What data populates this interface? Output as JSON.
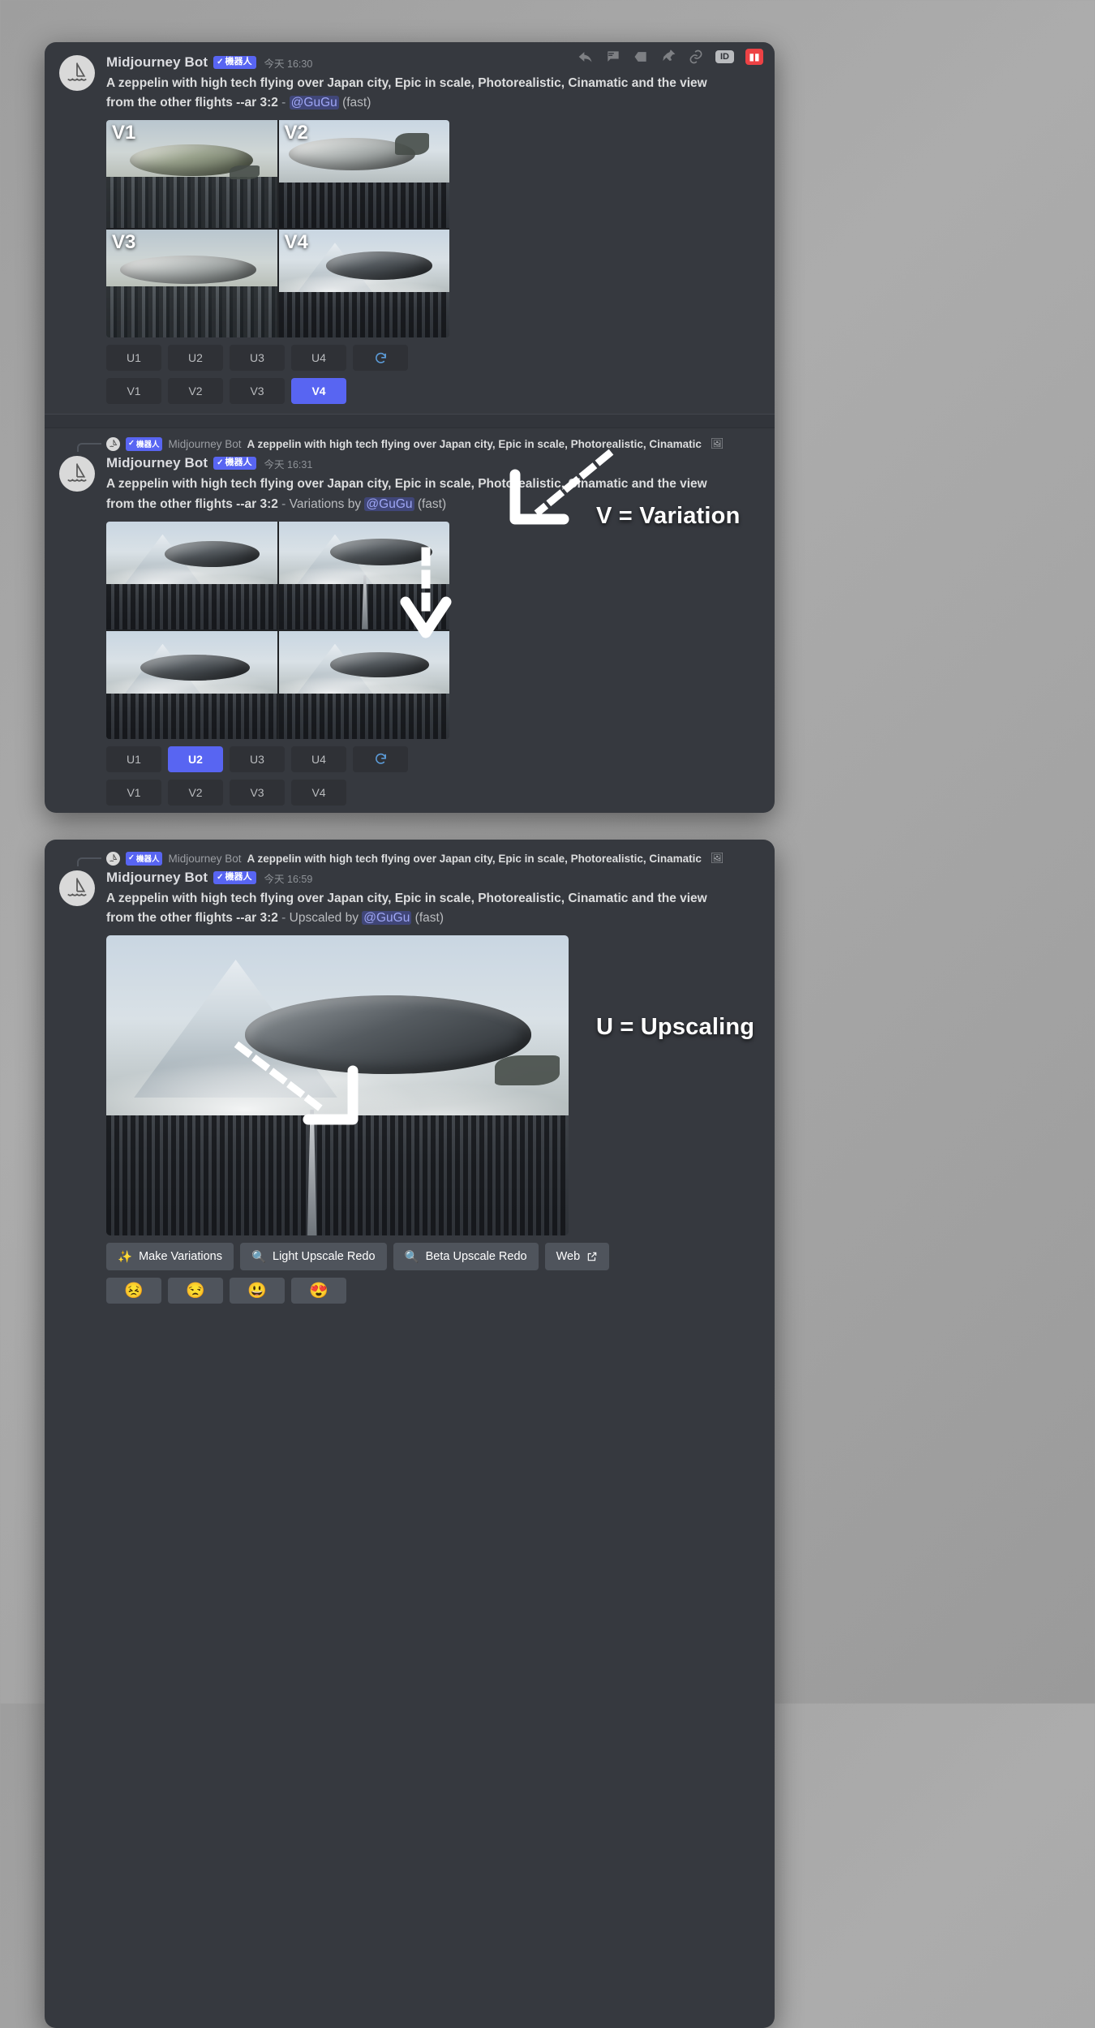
{
  "app": "Discord - Midjourney Bot conversation",
  "bot": {
    "name": "Midjourney Bot",
    "badge_label": "機器人",
    "badge_check": "✓",
    "avatar_icon": "sailboat-icon"
  },
  "messages": [
    {
      "id": "message-1",
      "timestamp_prefix": "今天",
      "timestamp": "16:30",
      "prompt_line1": "A zeppelin with high tech flying over Japan city, Epic in scale, Photorealistic, Cinamatic and the view",
      "prompt_line2_bold": "from the other flights --ar 3:2",
      "separator": "-",
      "action_text": "",
      "mention": "@GuGu",
      "speed": "(fast)",
      "grid_labels": [
        "V1",
        "V2",
        "V3",
        "V4"
      ],
      "upscale_buttons": [
        "U1",
        "U2",
        "U3",
        "U4"
      ],
      "variation_buttons": [
        "V1",
        "V2",
        "V3",
        "V4"
      ],
      "reroll_icon": "refresh-icon",
      "active_button": "V4"
    },
    {
      "id": "message-2",
      "timestamp_prefix": "今天",
      "timestamp": "16:31",
      "prompt_line1": "A zeppelin with high tech flying over Japan city, Epic in scale, Photorealistic, Cinamatic and the view",
      "prompt_line2_bold": "from the other flights --ar 3:2",
      "separator": "-",
      "action_text": "Variations by",
      "mention": "@GuGu",
      "speed": "(fast)",
      "upscale_buttons": [
        "U1",
        "U2",
        "U3",
        "U4"
      ],
      "variation_buttons": [
        "V1",
        "V2",
        "V3",
        "V4"
      ],
      "reroll_icon": "refresh-icon",
      "active_button": "U2"
    },
    {
      "id": "message-3",
      "timestamp_prefix": "今天",
      "timestamp": "16:59",
      "prompt_line1": "A zeppelin with high tech flying over Japan city, Epic in scale, Photorealistic, Cinamatic and the view",
      "prompt_line2_bold": "from the other flights --ar 3:2",
      "separator": "-",
      "action_text": "Upscaled by",
      "mention": "@GuGu",
      "speed": "(fast)"
    }
  ],
  "reply_refs": [
    {
      "id": "reply-ref-1",
      "badge_label": "機器人",
      "badge_check": "✓",
      "name": "Midjourney Bot",
      "preview": "A zeppelin with high tech flying over Japan city, Epic in scale, Photorealistic, Cinamatic",
      "attachment_icon": "image-icon"
    },
    {
      "id": "reply-ref-2",
      "badge_label": "機器人",
      "badge_check": "✓",
      "name": "Midjourney Bot",
      "preview": "A zeppelin with high tech flying over Japan city, Epic in scale, Photorealistic, Cinamatic",
      "attachment_icon": "image-icon"
    }
  ],
  "toolbar": {
    "reply_icon": "reply-arrow-icon",
    "thread_icon": "thread-icon",
    "unread_icon": "mark-unread-icon",
    "pin_icon": "pin-icon",
    "link_icon": "copy-link-icon",
    "id_label": "ID",
    "delete_icon": "delete-icon"
  },
  "final_actions": {
    "make_variations": {
      "label": "Make Variations",
      "icon": "magic-wand-icon"
    },
    "light_upscale": {
      "label": "Light Upscale Redo",
      "icon": "magnifier-icon"
    },
    "beta_upscale": {
      "label": "Beta Upscale Redo",
      "icon": "magnifier-icon"
    },
    "web": {
      "label": "Web",
      "icon": "external-link-icon"
    },
    "reactions": [
      "😣",
      "😒",
      "😃",
      "😍"
    ]
  },
  "annotations": [
    {
      "id": "annotation-variation",
      "text": "V = Variation"
    },
    {
      "id": "annotation-upscaling",
      "text": "U = Upscaling"
    }
  ],
  "colors": {
    "blurple": "#5865f2",
    "panel_bg": "#36393f",
    "button_bg": "#4f545c",
    "text_primary": "#dcddde",
    "text_muted": "#8e9297",
    "delete_red": "#ed4245"
  }
}
